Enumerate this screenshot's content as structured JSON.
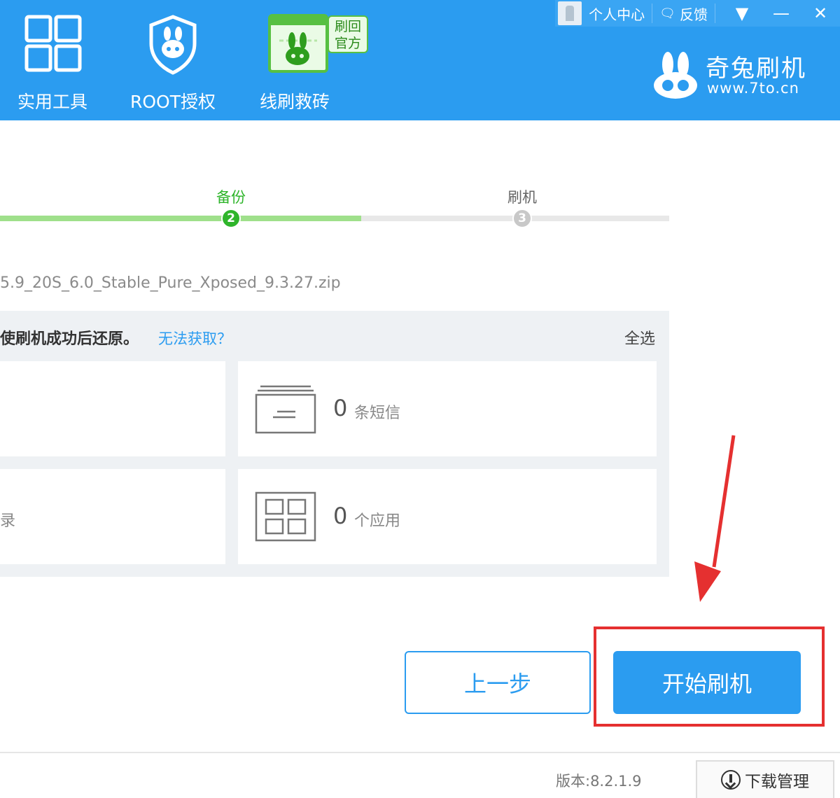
{
  "nav": {
    "tools_label": "实用工具",
    "root_label": "ROOT授权",
    "rescue_label": "线刷救砖",
    "promo_line1": "刷回",
    "promo_line2": "官方"
  },
  "topbar": {
    "user_center": "个人中心",
    "feedback": "反馈"
  },
  "brand": {
    "name": "奇兔刷机",
    "url": "www.7to.cn"
  },
  "steps": {
    "backup_label": "备份",
    "backup_number": "2",
    "flash_label": "刷机",
    "flash_number": "3",
    "progress_percent": 54
  },
  "rom": {
    "filename": "5.9_20S_6.0_Stable_Pure_Xposed_9.3.27.zip"
  },
  "panel": {
    "note": "使刷机成功后还原。",
    "help_link": "无法获取？",
    "select_all": "全选",
    "cards": [
      {
        "count": "",
        "unit": ""
      },
      {
        "count": "0",
        "unit": "条短信"
      },
      {
        "count": "",
        "unit": "录"
      },
      {
        "count": "0",
        "unit": "个应用"
      }
    ]
  },
  "buttons": {
    "prev": "上一步",
    "start": "开始刷机"
  },
  "footer": {
    "version": "版本:8.2.1.9",
    "download_manager": "下载管理"
  },
  "colors": {
    "header": "#2b9cf0",
    "accent": "#2b9cf0",
    "success": "#2fb52b",
    "highlight": "#e53030"
  }
}
